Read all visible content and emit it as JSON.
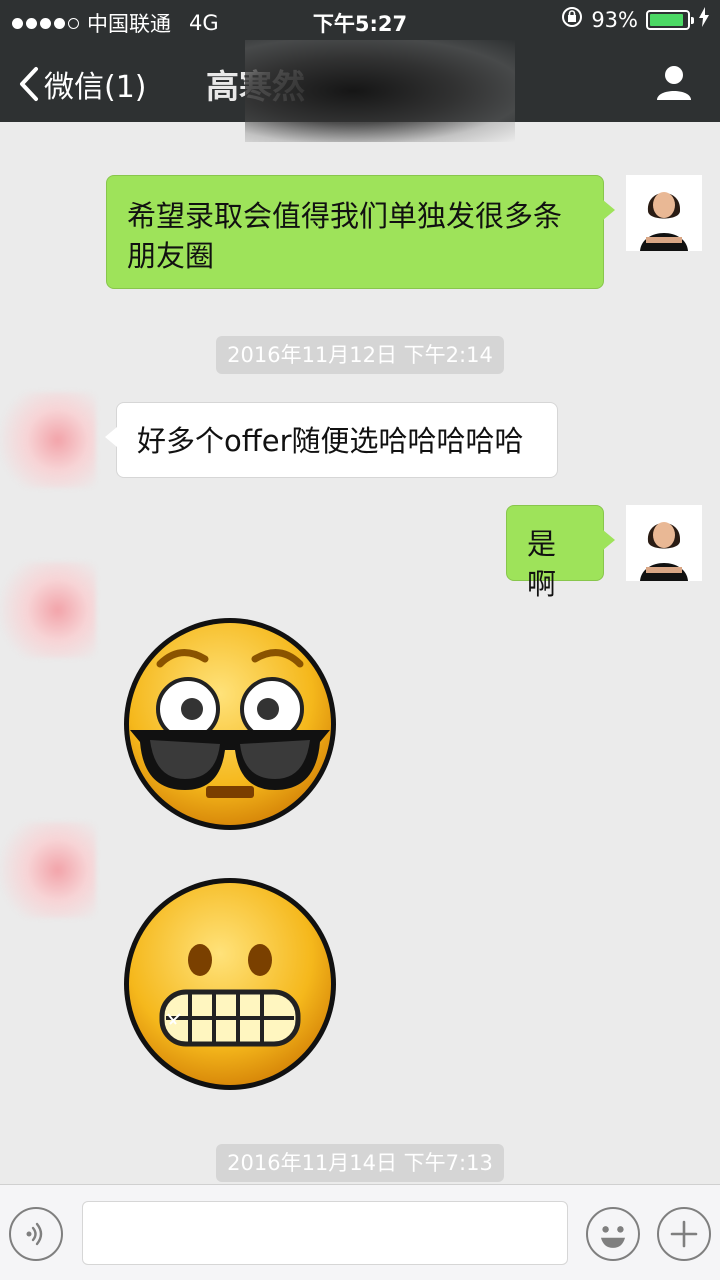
{
  "status_bar": {
    "carrier": "中国联通",
    "network": "4G",
    "time": "下午5:27",
    "battery_percent": "93%",
    "battery_level": 0.93
  },
  "nav": {
    "back_label": "微信(1)",
    "title": "高寒然"
  },
  "messages": {
    "m1": "希望录取会值得我们单独发很多条朋友圈",
    "ts1": "2016年11月12日 下午2:14",
    "m2": "好多个offer随便选哈哈哈哈哈",
    "m3": "是啊",
    "ts2": "2016年11月14日 下午7:13"
  },
  "input": {
    "placeholder": ""
  },
  "colors": {
    "my_bubble": "#9ee35a",
    "nav_bg": "#2e3132",
    "chat_bg": "#ebebeb"
  }
}
